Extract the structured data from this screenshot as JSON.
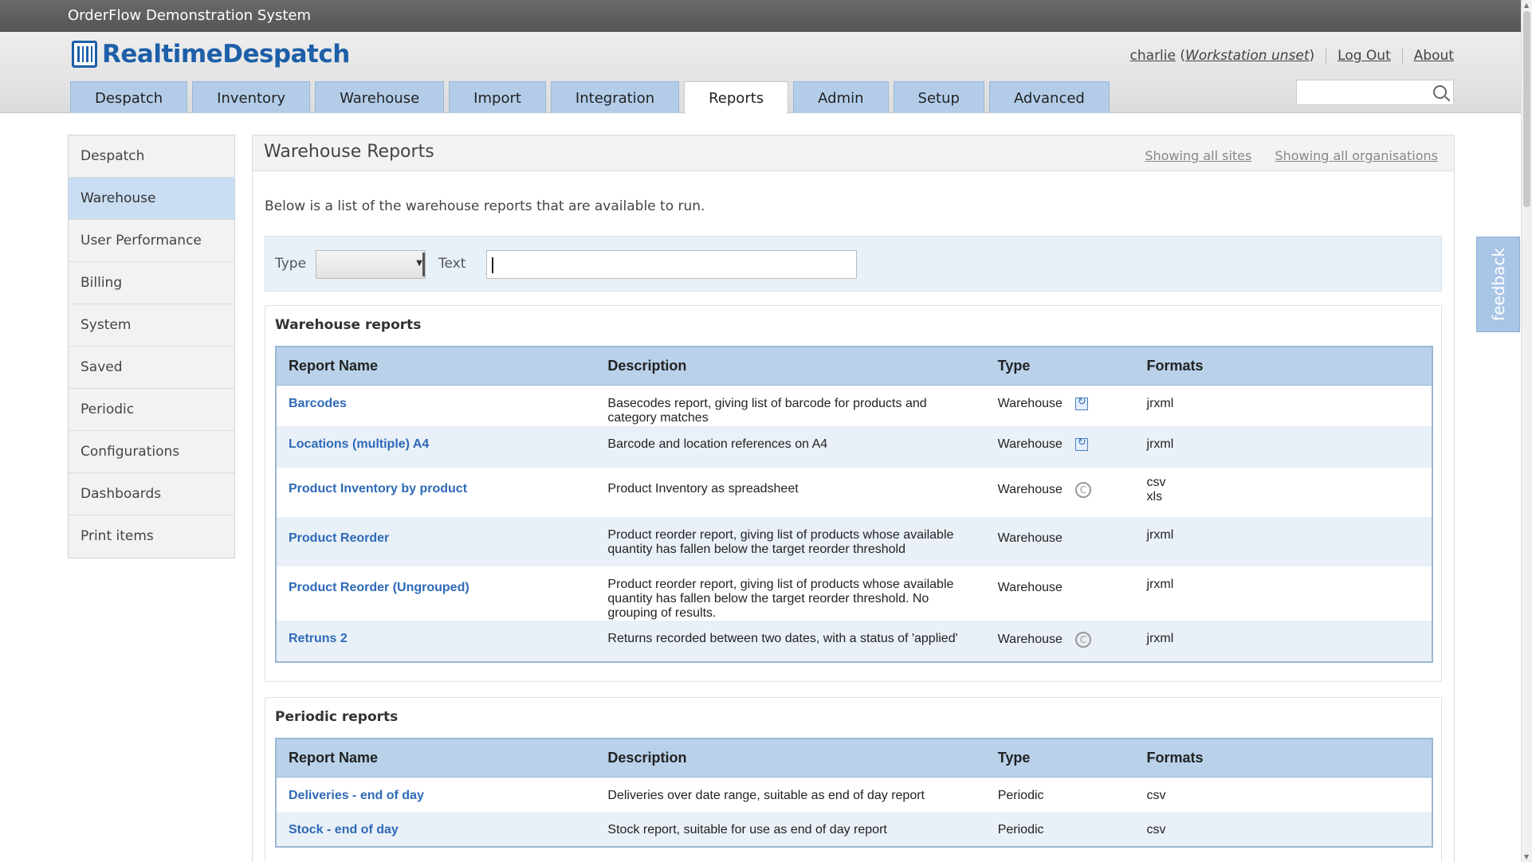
{
  "window_title": "OrderFlow Demonstration System",
  "logo": {
    "text": "RealtimeDespatch"
  },
  "user": {
    "name": "charlie",
    "workstation": "Workstation unset",
    "logout": "Log Out",
    "about": "About"
  },
  "tabs": [
    "Despatch",
    "Inventory",
    "Warehouse",
    "Import",
    "Integration",
    "Reports",
    "Admin",
    "Setup",
    "Advanced"
  ],
  "active_tab": "Reports",
  "search": {
    "placeholder": ""
  },
  "sidebar": [
    "Despatch",
    "Warehouse",
    "User Performance",
    "Billing",
    "System",
    "Saved",
    "Periodic",
    "Configurations",
    "Dashboards",
    "Print items"
  ],
  "active_sidebar": "Warehouse",
  "page": {
    "title": "Warehouse Reports",
    "showing_sites": "Showing all sites",
    "showing_orgs": "Showing all organisations",
    "intro": "Below is a list of the warehouse reports that are available to run."
  },
  "filter": {
    "type_label": "Type",
    "type_value": "",
    "text_label": "Text",
    "text_value": ""
  },
  "columns": [
    "Report Name",
    "Description",
    "Type",
    "Formats"
  ],
  "warehouse_section": {
    "title": "Warehouse reports",
    "rows": [
      {
        "name": "Barcodes",
        "description": "Basecodes report, giving list of barcode for products and category matches",
        "type": "Warehouse",
        "icon": "refresh-icon",
        "formats": [
          "jrxml"
        ]
      },
      {
        "name": "Locations (multiple) A4",
        "description": "Barcode and location references on A4",
        "type": "Warehouse",
        "icon": "refresh-icon",
        "formats": [
          "jrxml"
        ]
      },
      {
        "name": "Product Inventory by product",
        "description": "Product Inventory as spreadsheet",
        "type": "Warehouse",
        "icon": "copyright-icon",
        "formats": [
          "csv",
          "xls"
        ]
      },
      {
        "name": "Product Reorder",
        "description": "Product reorder report, giving list of products whose available quantity has fallen below the target reorder threshold",
        "type": "Warehouse",
        "icon": "",
        "formats": [
          "jrxml"
        ]
      },
      {
        "name": "Product Reorder (Ungrouped)",
        "description": "Product reorder report, giving list of products whose available quantity has fallen below the target reorder threshold. No grouping of results.",
        "type": "Warehouse",
        "icon": "",
        "formats": [
          "jrxml"
        ]
      },
      {
        "name": "Retruns 2",
        "description": "Returns recorded between two dates, with a status of 'applied'",
        "type": "Warehouse",
        "icon": "copyright-icon",
        "formats": [
          "jrxml"
        ]
      }
    ]
  },
  "periodic_section": {
    "title": "Periodic reports",
    "rows": [
      {
        "name": "Deliveries - end of day",
        "description": "Deliveries over date range, suitable as end of day report",
        "type": "Periodic",
        "icon": "",
        "formats": [
          "csv"
        ]
      },
      {
        "name": "Stock - end of day",
        "description": "Stock report, suitable for use as end of day report",
        "type": "Periodic",
        "icon": "",
        "formats": [
          "csv"
        ]
      }
    ]
  },
  "feedback": "feedback",
  "colors": {
    "tab": "#b3cde9",
    "table_header": "#b9d2ea",
    "link": "#2e6ab8",
    "sidebar_active": "#c9ddf3"
  }
}
